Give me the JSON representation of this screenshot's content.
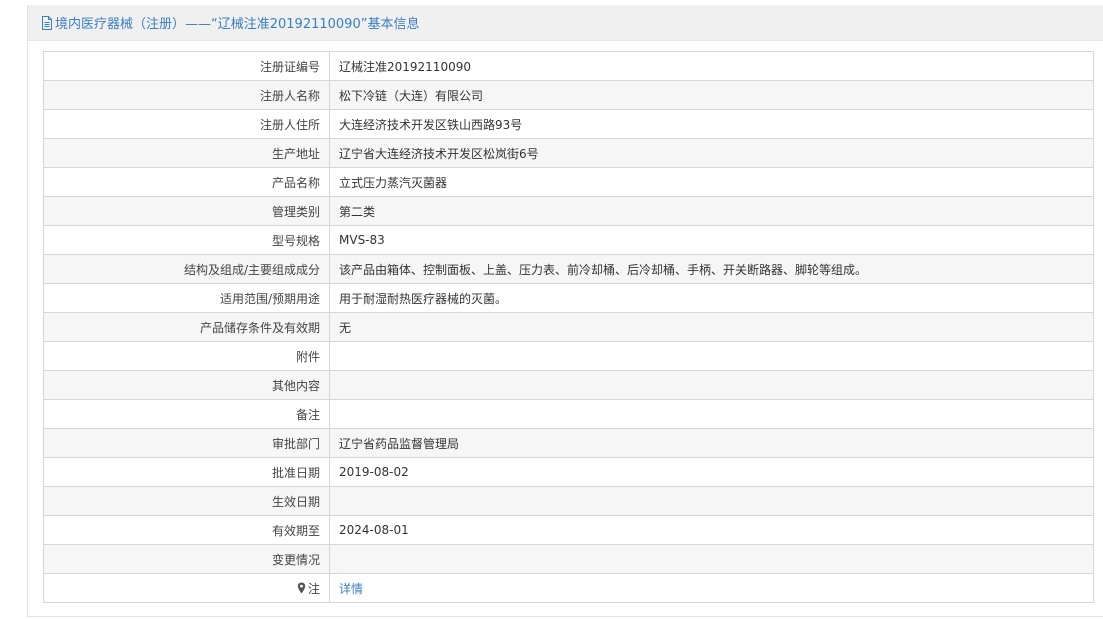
{
  "header": {
    "title": "境内医疗器械（注册）——“辽械注准20192110090”基本信息",
    "icon": "document-icon"
  },
  "colors": {
    "accent": "#3a7fc3",
    "header_bg": "#f0f0f0",
    "row_alt_bg": "#f6f6f6",
    "border": "#d6d6d6"
  },
  "rows": [
    {
      "label": "注册证编号",
      "value": "辽械注准20192110090"
    },
    {
      "label": "注册人名称",
      "value": "松下冷链（大连）有限公司"
    },
    {
      "label": "注册人住所",
      "value": "大连经济技术开发区铁山西路93号"
    },
    {
      "label": "生产地址",
      "value": "辽宁省大连经济技术开发区松岚街6号"
    },
    {
      "label": "产品名称",
      "value": "立式压力蒸汽灭菌器"
    },
    {
      "label": "管理类别",
      "value": "第二类"
    },
    {
      "label": "型号规格",
      "value": "MVS-83"
    },
    {
      "label": "结构及组成/主要组成成分",
      "value": "该产品由箱体、控制面板、上盖、压力表、前冷却桶、后冷却桶、手柄、开关断路器、脚轮等组成。"
    },
    {
      "label": "适用范围/预期用途",
      "value": "用于耐湿耐热医疗器械的灭菌。"
    },
    {
      "label": "产品储存条件及有效期",
      "value": "无"
    },
    {
      "label": "附件",
      "value": ""
    },
    {
      "label": "其他内容",
      "value": ""
    },
    {
      "label": "备注",
      "value": ""
    },
    {
      "label": "审批部门",
      "value": "辽宁省药品监督管理局"
    },
    {
      "label": "批准日期",
      "value": "2019-08-02"
    },
    {
      "label": "生效日期",
      "value": ""
    },
    {
      "label": "有效期至",
      "value": "2024-08-01"
    },
    {
      "label": "变更情况",
      "value": ""
    }
  ],
  "note_row": {
    "label": "注",
    "icon": "pin-icon",
    "link_text": "详情"
  }
}
